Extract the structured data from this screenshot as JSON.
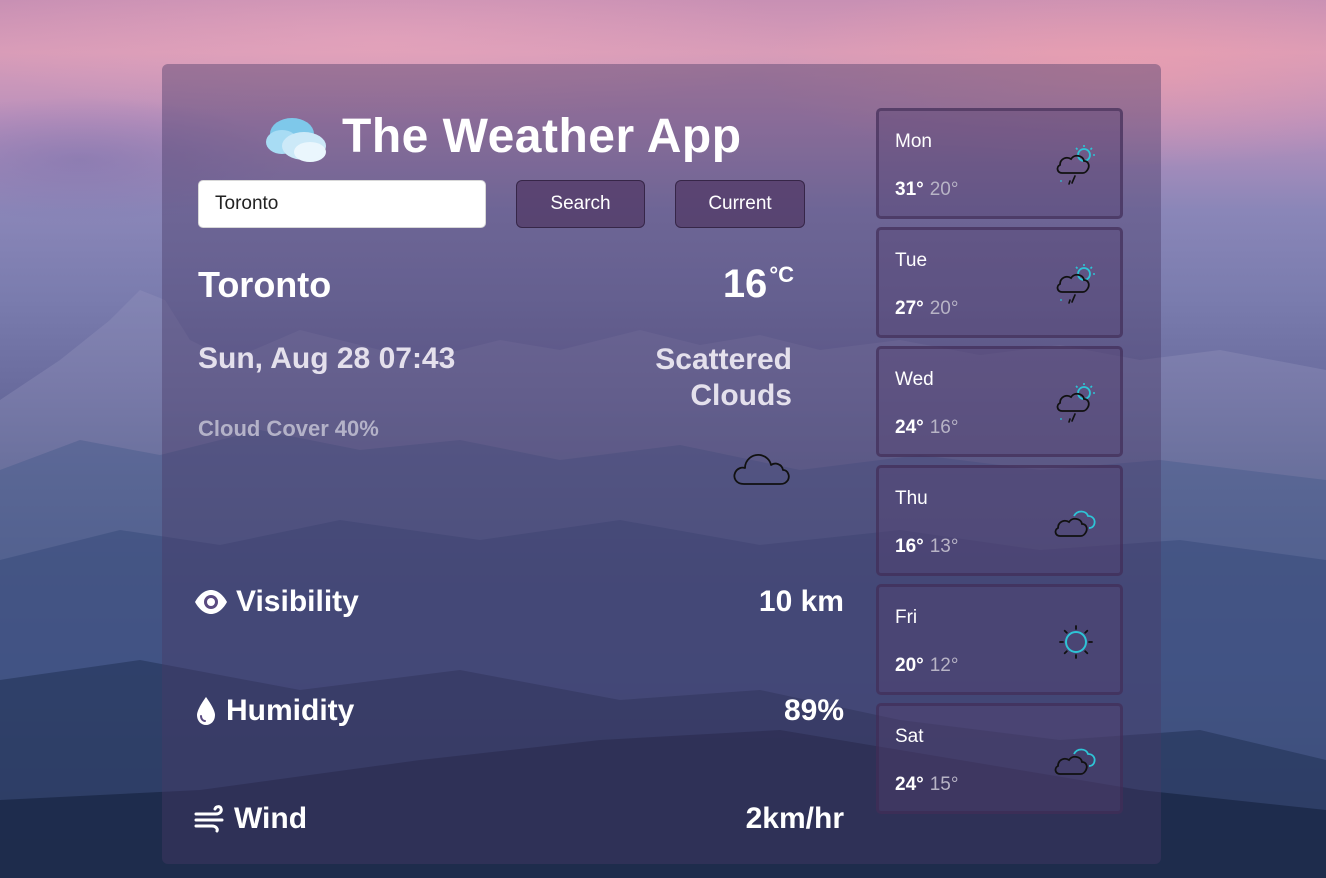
{
  "app": {
    "title": "The Weather App"
  },
  "search": {
    "value": "Toronto",
    "search_label": "Search",
    "current_label": "Current"
  },
  "current": {
    "city": "Toronto",
    "temp": "16",
    "unit": "°C",
    "datetime": "Sun, Aug 28 07:43",
    "condition": "Scattered Clouds",
    "cloud_cover_label": "Cloud Cover",
    "cloud_cover_value": "40%",
    "icon": "cloud-icon"
  },
  "stats": {
    "visibility": {
      "label": "Visibility",
      "value": "10 km",
      "icon": "eye-icon"
    },
    "humidity": {
      "label": "Humidity",
      "value": "89%",
      "icon": "droplet-icon"
    },
    "wind": {
      "label": "Wind",
      "value": "2km/hr",
      "icon": "wind-icon"
    }
  },
  "forecast": [
    {
      "day": "Mon",
      "high": "31°",
      "low": "20°",
      "icon": "sun-cloud-rain-icon"
    },
    {
      "day": "Tue",
      "high": "27°",
      "low": "20°",
      "icon": "sun-cloud-rain-icon"
    },
    {
      "day": "Wed",
      "high": "24°",
      "low": "16°",
      "icon": "sun-cloud-rain-icon"
    },
    {
      "day": "Thu",
      "high": "16°",
      "low": "13°",
      "icon": "clouds-icon"
    },
    {
      "day": "Fri",
      "high": "20°",
      "low": "12°",
      "icon": "sun-icon"
    },
    {
      "day": "Sat",
      "high": "24°",
      "low": "15°",
      "icon": "clouds-icon"
    }
  ],
  "colors": {
    "accent_icon": "#2ec4d6",
    "panel": "#483a66",
    "button": "#503864"
  }
}
